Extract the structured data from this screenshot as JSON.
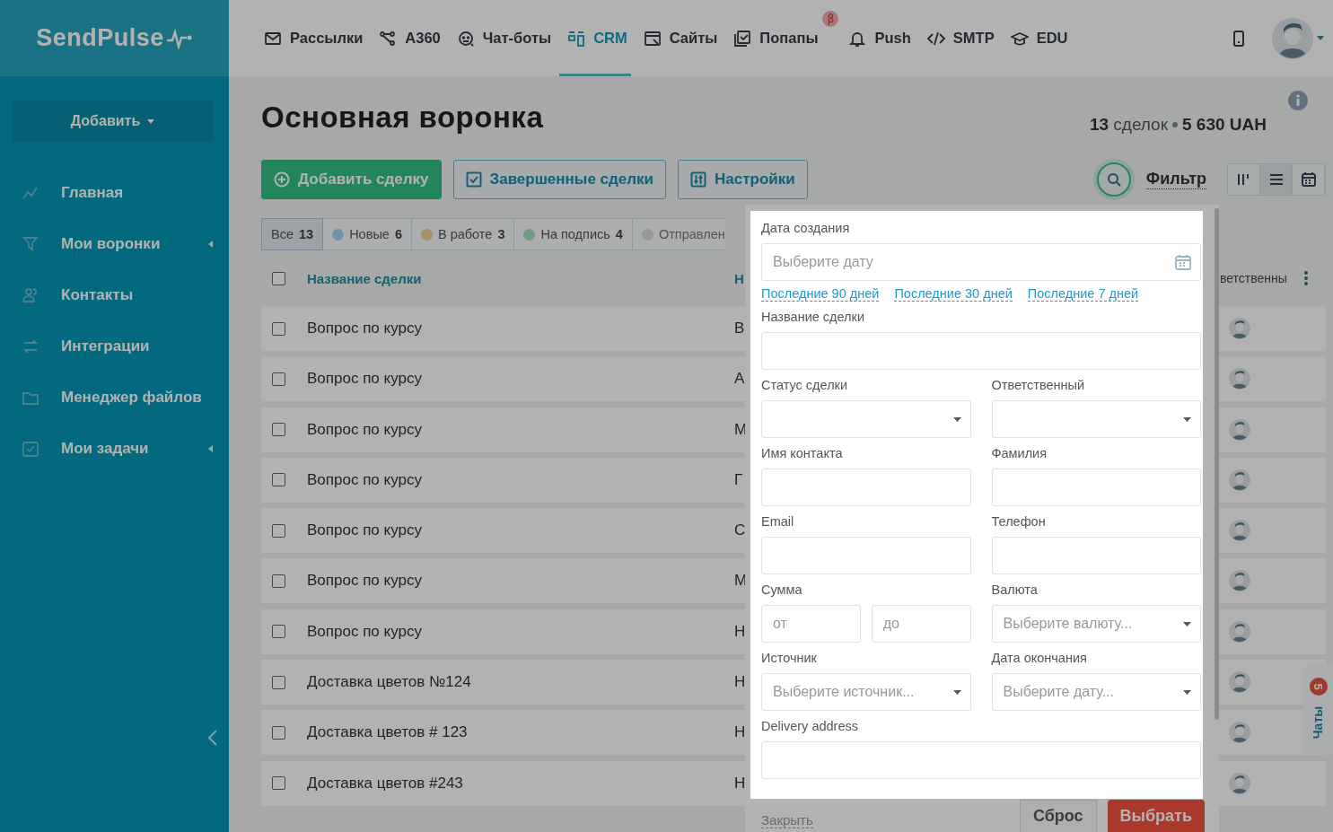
{
  "sidebar": {
    "logo": "SendPulse",
    "add_button": "Добавить",
    "items": [
      {
        "label": "Главная",
        "expandable": false
      },
      {
        "label": "Мои воронки",
        "expandable": true
      },
      {
        "label": "Контакты",
        "expandable": false
      },
      {
        "label": "Интеграции",
        "expandable": false
      },
      {
        "label": "Менеджер файлов",
        "expandable": false
      },
      {
        "label": "Мои задачи",
        "expandable": true
      }
    ]
  },
  "topnav": [
    {
      "label": "Рассылки",
      "selected": false
    },
    {
      "label": "A360",
      "selected": false
    },
    {
      "label": "Чат-боты",
      "selected": false
    },
    {
      "label": "CRM",
      "selected": true
    },
    {
      "label": "Сайты",
      "selected": false
    },
    {
      "label": "Попапы",
      "selected": false,
      "badge": "β"
    },
    {
      "label": "Push",
      "selected": false
    },
    {
      "label": "SMTP",
      "selected": false
    },
    {
      "label": "EDU",
      "selected": false
    }
  ],
  "page": {
    "title": "Основная воронка",
    "deal_count": "13",
    "deal_count_label": "сделок",
    "total": "5 630 UAH",
    "buttons": [
      {
        "label": "Добавить сделку",
        "kind": "primary"
      },
      {
        "label": "Завершенные сделки",
        "kind": "completed"
      },
      {
        "label": "Настройки",
        "kind": "settings"
      }
    ],
    "filter_label": "Фильтр",
    "views": [
      {
        "kind": "board",
        "selected": false
      },
      {
        "kind": "list",
        "selected": true
      },
      {
        "kind": "calendar",
        "selected": false
      }
    ]
  },
  "stages": [
    {
      "label": "Все",
      "count": "13",
      "selected": true
    },
    {
      "label": "Новые",
      "count": "6",
      "color": "#6f94a3",
      "selected": false
    },
    {
      "label": "В работе",
      "count": "3",
      "color": "#a88f67",
      "selected": false
    },
    {
      "label": "На подпись",
      "count": "4",
      "color": "#6f9a83",
      "selected": false
    },
    {
      "label": "Отправлен",
      "color": "#989898",
      "selected": false
    }
  ],
  "table": {
    "all_checked": false,
    "columns": [
      "Название сделки",
      "Н",
      "ветственны"
    ],
    "rows": [
      {
        "name": "Вопрос по курсу",
        "column_2": "В",
        "checked": false
      },
      {
        "name": "Вопрос по курсу",
        "column_2": "А",
        "checked": false
      },
      {
        "name": "Вопрос по курсу",
        "column_2": "М",
        "checked": false
      },
      {
        "name": "Вопрос по курсу",
        "column_2": "Г",
        "checked": false
      },
      {
        "name": "Вопрос по курсу",
        "column_2": "С",
        "checked": false
      },
      {
        "name": "Вопрос по курсу",
        "column_2": "М",
        "checked": false
      },
      {
        "name": "Вопрос по курсу",
        "column_2": "Н",
        "checked": false
      },
      {
        "name": "Доставка цветов №124",
        "column_2": "Н",
        "checked": false
      },
      {
        "name": "Доставка цветов # 123",
        "column_2": "Н",
        "checked": false
      },
      {
        "name": "Доставка цветов #243",
        "column_2": "Н",
        "checked": false
      }
    ]
  },
  "filter": {
    "rows": [
      [
        {
          "label": "Дата создания",
          "kind": "date",
          "placeholder": "Выберите дату",
          "presets": [
            "Последние 90 дней",
            "Последние 30 дней",
            "Последние 7 дней"
          ]
        }
      ],
      [
        {
          "label": "Название сделки",
          "kind": "text"
        }
      ],
      [
        {
          "label": "Статус сделки",
          "kind": "select"
        },
        {
          "label": "Ответственный",
          "kind": "select"
        }
      ],
      [
        {
          "label": "Имя контакта",
          "kind": "text"
        },
        {
          "label": "Фамилия",
          "kind": "text"
        }
      ],
      [
        {
          "label": "Email",
          "kind": "text"
        },
        {
          "label": "Телефон",
          "kind": "text"
        }
      ],
      [
        {
          "label": "Сумма",
          "kind": "range",
          "from": "от",
          "to": "до"
        },
        {
          "label": "Валюта",
          "kind": "select",
          "placeholder": "Выберите валюту..."
        }
      ],
      [
        {
          "label": "Источник",
          "kind": "select",
          "placeholder": "Выберите источник..."
        },
        {
          "label": "Дата окончания",
          "kind": "select",
          "placeholder": "Выберите дату..."
        }
      ],
      [
        {
          "label": "Delivery address",
          "kind": "text"
        }
      ]
    ],
    "close": "Закрыть",
    "reset": "Сброс",
    "apply": "Выбрать"
  },
  "chats": {
    "label": "Чаты",
    "badge": "5"
  }
}
